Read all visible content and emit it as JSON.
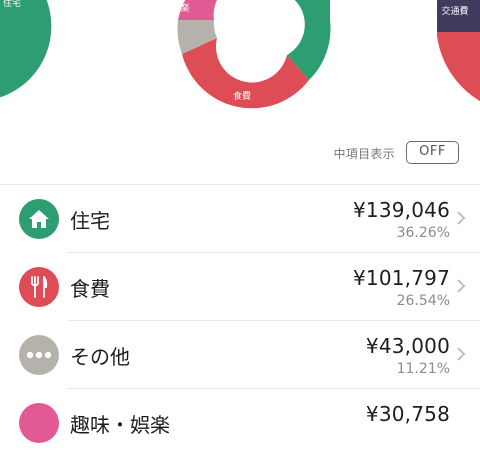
{
  "chart": {
    "labels": {
      "housing_left": "住宅",
      "hobby": "趣味・娯楽",
      "other": "その他",
      "food": "食費",
      "transport": "交通費"
    }
  },
  "toggle": {
    "label": "中項目表示",
    "value": "OFF"
  },
  "colors": {
    "housing": "#2e9d72",
    "food": "#de4c56",
    "other": "#b5b2ac",
    "hobby": "#e15a94",
    "transport": "#3f3c5e"
  },
  "categories": [
    {
      "name": "住宅",
      "amount": "¥139,046",
      "percent": "36.26%",
      "icon": "house-icon"
    },
    {
      "name": "食費",
      "amount": "¥101,797",
      "percent": "26.54%",
      "icon": "fork-knife-icon"
    },
    {
      "name": "その他",
      "amount": "¥43,000",
      "percent": "11.21%",
      "icon": "ellipsis-icon"
    },
    {
      "name": "趣味・娯楽",
      "amount": "¥30,758",
      "percent": "",
      "icon": "hobby-icon"
    }
  ]
}
